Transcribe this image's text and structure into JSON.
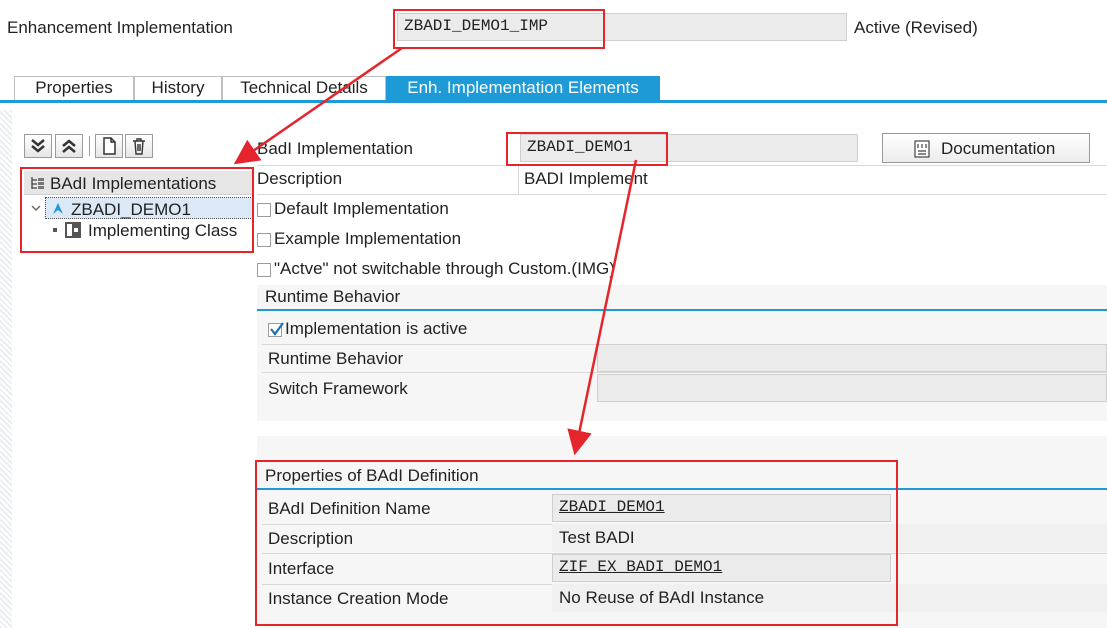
{
  "header": {
    "label": "Enhancement Implementation",
    "value": "ZBADI_DEMO1_IMP",
    "status": "Active (Revised)"
  },
  "tabs": [
    {
      "label": "Properties"
    },
    {
      "label": "History"
    },
    {
      "label": "Technical Details"
    },
    {
      "label": "Enh. Implementation Elements"
    }
  ],
  "tree": {
    "header": "BAdI Implementations",
    "node": "ZBADI_DEMO1",
    "child": "Implementing Class"
  },
  "badi": {
    "impl_label": "BadI Implementation",
    "impl_value": "ZBADI_DEMO1",
    "doc_button": "Documentation",
    "desc_label": "Description",
    "desc_value": "BADI Implement",
    "default_impl": "Default Implementation",
    "example_impl": "Example Implementation",
    "not_switchable": "\"Actve\" not switchable through Custom.(IMG)"
  },
  "runtime": {
    "title": "Runtime Behavior",
    "active_label": "Implementation is active",
    "behavior_label": "Runtime Behavior",
    "switch_label": "Switch Framework"
  },
  "definition": {
    "title": "Properties of BAdI Definition",
    "name_label": "BAdI Definition Name",
    "name_value": "ZBADI_DEMO1",
    "desc_label": "Description",
    "desc_value": "Test BADI",
    "intf_label": "Interface",
    "intf_value": "ZIF_EX_BADI_DEMO1",
    "mode_label": "Instance Creation Mode",
    "mode_value": "No Reuse of BAdI Instance"
  },
  "colors": {
    "accent": "#1e9bd7",
    "annotation": "#e4262c"
  }
}
